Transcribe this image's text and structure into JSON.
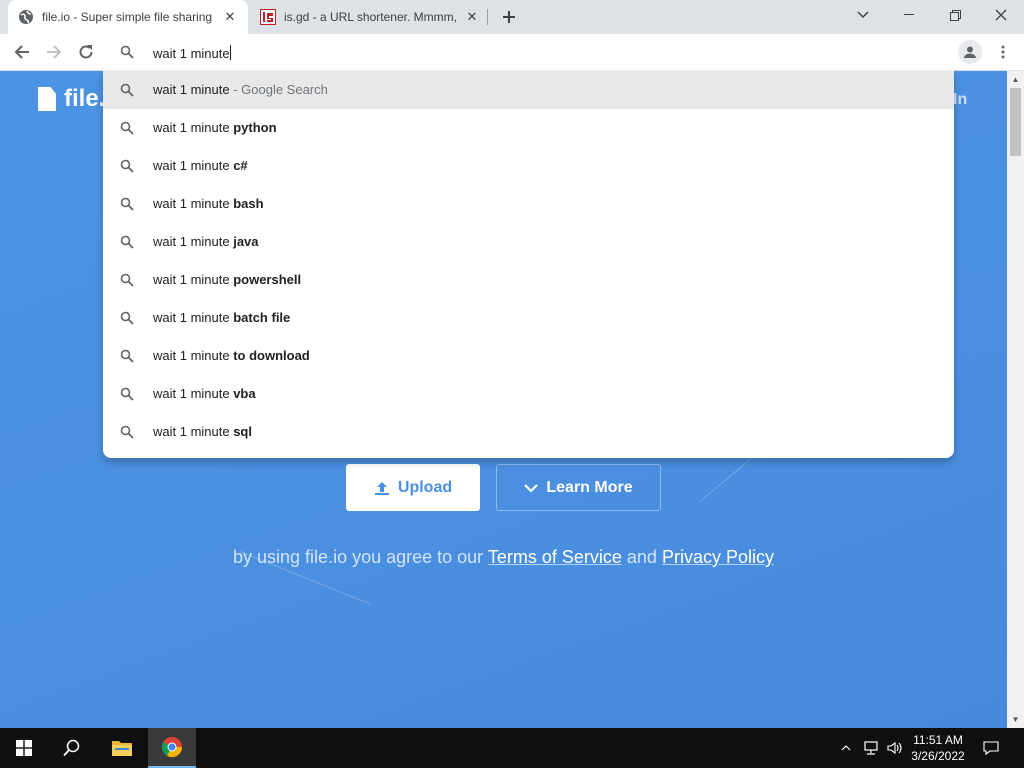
{
  "tabs": [
    {
      "title": "file.io - Super simple file sharing",
      "favicon": "globe-icon"
    },
    {
      "title": "is.gd - a URL shortener. Mmmm,",
      "favicon": "isgd-icon"
    }
  ],
  "omnibox": {
    "value": "wait 1 minute"
  },
  "suggestions": [
    {
      "prefix": "wait 1 minute",
      "bold": "",
      "suffix": " - Google Search"
    },
    {
      "prefix": "wait 1 minute ",
      "bold": "python",
      "suffix": ""
    },
    {
      "prefix": "wait 1 minute ",
      "bold": "c#",
      "suffix": ""
    },
    {
      "prefix": "wait 1 minute ",
      "bold": "bash",
      "suffix": ""
    },
    {
      "prefix": "wait 1 minute ",
      "bold": "java",
      "suffix": ""
    },
    {
      "prefix": "wait 1 minute ",
      "bold": "powershell",
      "suffix": ""
    },
    {
      "prefix": "wait 1 minute ",
      "bold": "batch file",
      "suffix": ""
    },
    {
      "prefix": "wait 1 minute ",
      "bold": "to download",
      "suffix": ""
    },
    {
      "prefix": "wait 1 minute ",
      "bold": "vba",
      "suffix": ""
    },
    {
      "prefix": "wait 1 minute ",
      "bold": "sql",
      "suffix": ""
    }
  ],
  "page": {
    "logo": "file.",
    "login_fragment": "In",
    "upload_label": "Upload",
    "learn_more_label": "Learn More",
    "terms_prefix": "by using file.io you agree to our ",
    "terms_link": "Terms of Service",
    "terms_and": " and ",
    "privacy_link": "Privacy Policy"
  },
  "taskbar": {
    "time": "11:51 AM",
    "date": "3/26/2022"
  },
  "colors": {
    "accent": "#4a90e2",
    "tab_strip": "#dee1e6",
    "taskbar": "#101010"
  }
}
